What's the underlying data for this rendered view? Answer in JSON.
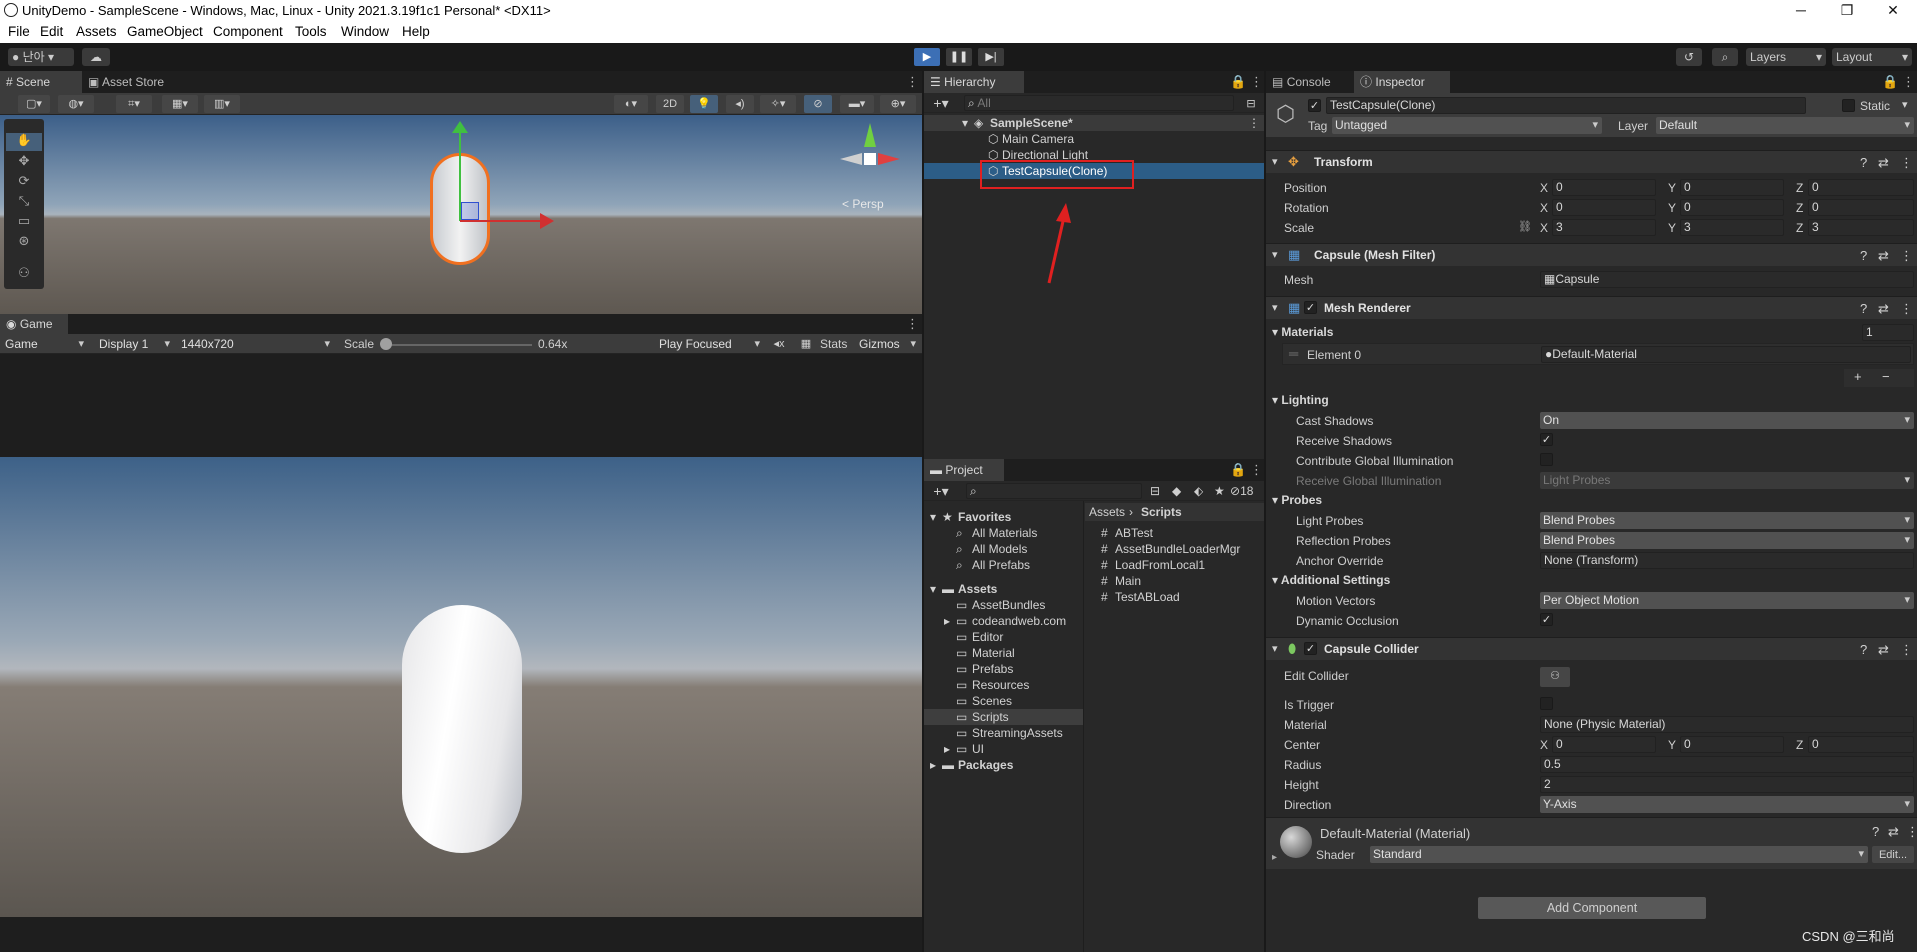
{
  "title_bar": {
    "title": "UnityDemo - SampleScene - Windows, Mac, Linux - Unity 2021.3.19f1c1 Personal* <DX11>",
    "minimize": "─",
    "restore": "❐",
    "close": "✕"
  },
  "menu": [
    "File",
    "Edit",
    "Assets",
    "GameObject",
    "Component",
    "Tools",
    "Window",
    "Help"
  ],
  "toolbar": {
    "account": "난아",
    "layers": "Layers",
    "layout": "Layout"
  },
  "scene": {
    "tabs": [
      "Scene",
      "Asset Store"
    ],
    "mode_2d": "2D",
    "persp": "< Persp"
  },
  "game": {
    "tab": "Game",
    "view": "Game",
    "display": "Display 1",
    "resolution": "1440x720",
    "scale_label": "Scale",
    "scale_value": "0.64x",
    "scale_level": 0.0,
    "play_focused": "Play Focused",
    "stats": "Stats",
    "gizmos": "Gizmos"
  },
  "hierarchy": {
    "tab": "Hierarchy",
    "search_placeholder": "All",
    "scene": "SampleScene*",
    "items": [
      "Main Camera",
      "Directional Light",
      "TestCapsule(Clone)"
    ]
  },
  "project": {
    "tab": "Project",
    "hidden_count": "18",
    "favorites": {
      "label": "Favorites",
      "items": [
        "All Materials",
        "All Models",
        "All Prefabs"
      ]
    },
    "assets": {
      "label": "Assets",
      "items": [
        "AssetBundles",
        "codeandweb.com",
        "Editor",
        "Material",
        "Prefabs",
        "Resources",
        "Scenes",
        "Scripts",
        "StreamingAssets",
        "UI"
      ]
    },
    "packages": "Packages",
    "breadcrumb": [
      "Assets",
      "Scripts"
    ],
    "files": [
      "ABTest",
      "AssetBundleLoaderMgr",
      "LoadFromLocal1",
      "Main",
      "TestABLoad"
    ]
  },
  "inspector": {
    "tabs": [
      "Console",
      "Inspector"
    ],
    "object_name": "TestCapsule(Clone)",
    "static": "Static",
    "tag_label": "Tag",
    "tag": "Untagged",
    "layer_label": "Layer",
    "layer": "Default",
    "transform": {
      "name": "Transform",
      "position": {
        "label": "Position",
        "x": "0",
        "y": "0",
        "z": "0"
      },
      "rotation": {
        "label": "Rotation",
        "x": "0",
        "y": "0",
        "z": "0"
      },
      "scale": {
        "label": "Scale",
        "x": "3",
        "y": "3",
        "z": "3"
      }
    },
    "mesh_filter": {
      "name": "Capsule (Mesh Filter)",
      "mesh_label": "Mesh",
      "mesh": "Capsule"
    },
    "mesh_renderer": {
      "name": "Mesh Renderer",
      "materials_label": "Materials",
      "materials_count": "1",
      "element_label": "Element 0",
      "element": "Default-Material",
      "lighting": "Lighting",
      "cast_shadows_label": "Cast Shadows",
      "cast_shadows": "On",
      "receive_shadows_label": "Receive Shadows",
      "contrib_gi_label": "Contribute Global Illumination",
      "receive_gi_label": "Receive Global Illumination",
      "receive_gi": "Light Probes",
      "probes": "Probes",
      "light_probes_label": "Light Probes",
      "light_probes": "Blend Probes",
      "reflection_probes_label": "Reflection Probes",
      "reflection_probes": "Blend Probes",
      "anchor_label": "Anchor Override",
      "anchor": "None (Transform)",
      "additional": "Additional Settings",
      "motion_label": "Motion Vectors",
      "motion": "Per Object Motion",
      "dynamic_occ_label": "Dynamic Occlusion"
    },
    "capsule_collider": {
      "name": "Capsule Collider",
      "edit_label": "Edit Collider",
      "trigger_label": "Is Trigger",
      "material_label": "Material",
      "material": "None (Physic Material)",
      "center_label": "Center",
      "cx": "0",
      "cy": "0",
      "cz": "0",
      "radius_label": "Radius",
      "radius": "0.5",
      "height_label": "Height",
      "height": "2",
      "direction_label": "Direction",
      "direction": "Y-Axis"
    },
    "material": {
      "name": "Default-Material (Material)",
      "shader_label": "Shader",
      "shader": "Standard",
      "edit": "Edit..."
    },
    "add_component": "Add Component"
  },
  "watermark": "CSDN @三和尚",
  "axis_labels": {
    "x": "X",
    "y": "Y",
    "z": "Z"
  },
  "colors": {
    "accent_blue": "#2c5d87",
    "selection_box": "#e02020",
    "play_active": "#3c6fb5"
  }
}
